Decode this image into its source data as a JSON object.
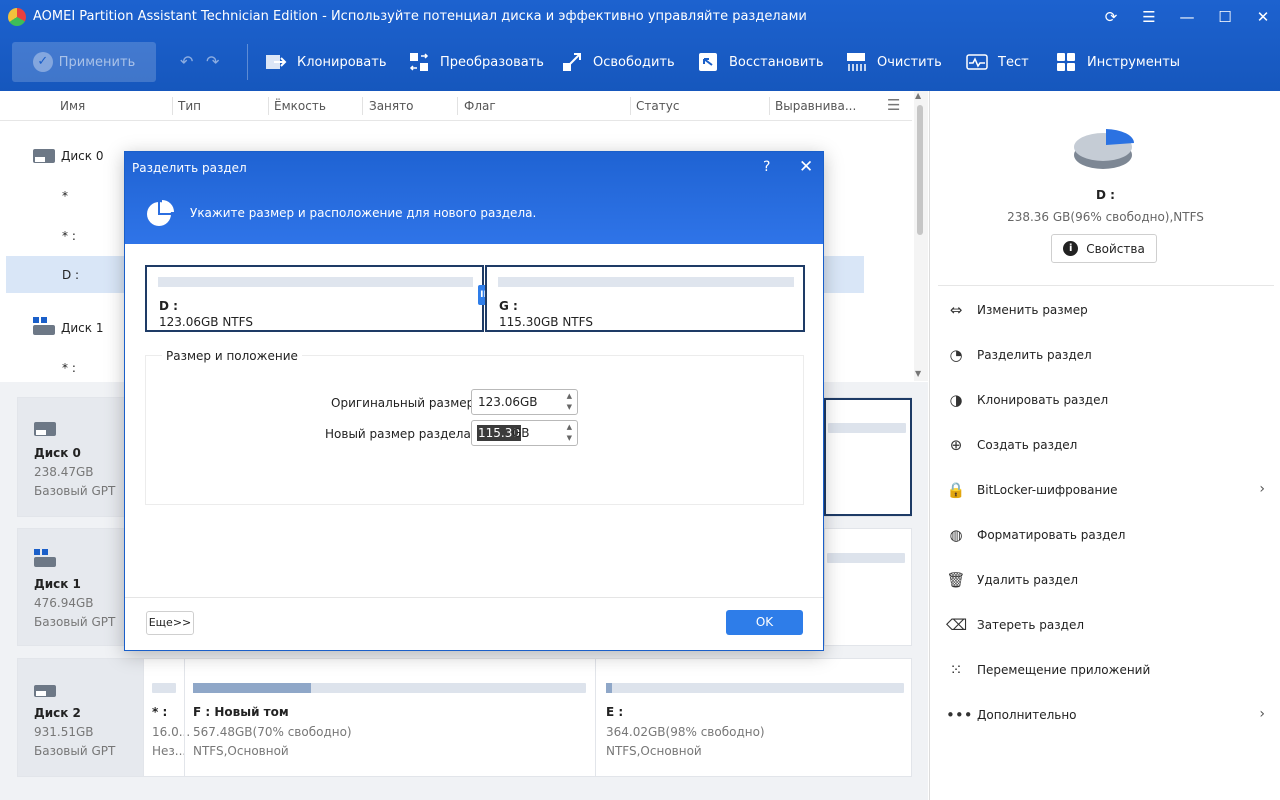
{
  "app": {
    "title": "AOMEI Partition Assistant Technician Edition - Используйте потенциал диска и эффективно управляйте разделами"
  },
  "toolbar": {
    "apply": "Применить",
    "clone": "Клонировать",
    "convert": "Преобразовать",
    "free": "Освободить",
    "restore": "Восстановить",
    "clean": "Очистить",
    "test": "Тест",
    "tools": "Инструменты"
  },
  "columns": [
    "Имя",
    "Тип",
    "Ёмкость",
    "Занято",
    "Флаг",
    "Статус",
    "Выравнива..."
  ],
  "tree": {
    "disk0": "Диск 0",
    "row1": "*",
    "row2": "* :",
    "row3": "D :",
    "disk1": "Диск 1",
    "row5": "* :"
  },
  "disks": [
    {
      "name": "Диск 0",
      "size": "238.47GB",
      "type": "Базовый GPT"
    },
    {
      "name": "Диск 1",
      "size": "476.94GB",
      "type": "Базовый GPT"
    },
    {
      "name": "Диск 2",
      "size": "931.51GB",
      "type": "Базовый GPT"
    }
  ],
  "disk2_parts": [
    {
      "name": "* :",
      "size": "16.0...",
      "fs": "Нез..."
    },
    {
      "name": "F : Новый том",
      "size": "567.48GB(70% свободно)",
      "fs": "NTFS,Основной",
      "used_pct": 30
    },
    {
      "name": "E :",
      "size": "364.02GB(98% свободно)",
      "fs": "NTFS,Основной",
      "used_pct": 2
    }
  ],
  "right": {
    "drive": "D :",
    "info": "238.36 GB(96% свободно),NTFS",
    "props": "Свойства",
    "ops": [
      {
        "label": "Изменить размер",
        "icon": "resize-icon",
        "glyph": "⇔",
        "chev": ""
      },
      {
        "label": "Разделить раздел",
        "icon": "split-icon",
        "glyph": "◔",
        "chev": ""
      },
      {
        "label": "Клонировать раздел",
        "icon": "clone-partition-icon",
        "glyph": "◑",
        "chev": ""
      },
      {
        "label": "Создать раздел",
        "icon": "create-partition-icon",
        "glyph": "⊕",
        "chev": ""
      },
      {
        "label": "BitLocker-шифрование",
        "icon": "lock-icon",
        "glyph": "🔒",
        "chev": "›"
      },
      {
        "label": "Форматировать раздел",
        "icon": "format-icon",
        "glyph": "◍",
        "chev": ""
      },
      {
        "label": "Удалить раздел",
        "icon": "trash-icon",
        "glyph": "🗑",
        "chev": ""
      },
      {
        "label": "Затереть раздел",
        "icon": "eraser-icon",
        "glyph": "⌫",
        "chev": ""
      },
      {
        "label": "Перемещение приложений",
        "icon": "apps-icon",
        "glyph": "⁙",
        "chev": ""
      },
      {
        "label": "Дополнительно",
        "icon": "more-icon",
        "glyph": "•••",
        "chev": "›"
      }
    ]
  },
  "dialog": {
    "title": "Разделить раздел",
    "help": "?",
    "close": "✕",
    "subtitle": "Укажите размер и расположение для нового раздела.",
    "left_part": {
      "name": "D :",
      "size": "123.06GB NTFS"
    },
    "right_part": {
      "name": "G :",
      "size": "115.30GB NTFS"
    },
    "group": "Размер и положение",
    "orig_label": "Оригинальный размер",
    "orig_value": "123.06GB",
    "new_label": "Новый размер раздела:",
    "new_value": "115.30",
    "new_unit": "GB",
    "more": "Еще>>",
    "ok": "OK"
  }
}
